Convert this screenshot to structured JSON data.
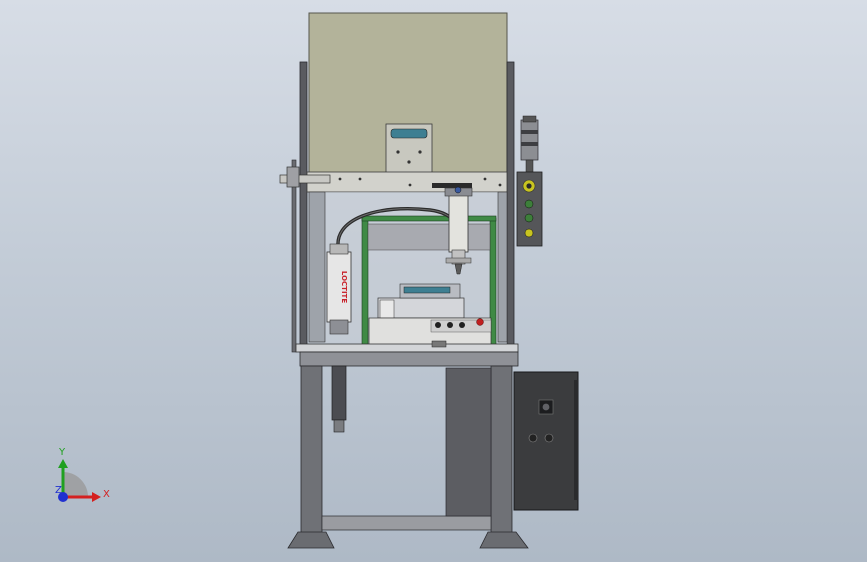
{
  "viewport": {
    "background_top": "#d7dde6",
    "background_bottom": "#aeb9c6"
  },
  "model": {
    "labels": {
      "dispenser_brand": "LOCTITE"
    },
    "colors": {
      "upper_panel": "#b3b39a",
      "frame_steel": "#4c4d52",
      "green_post": "#3f8a45",
      "control_cabinet": "#3b3c3e",
      "beacon_green": "#3d7f3a",
      "beacon_yellow": "#c8c420",
      "indicator_red": "#c02020"
    }
  },
  "triad": {
    "x_label": "X",
    "y_label": "Y",
    "z_label": "Z",
    "x_color": "#d42020",
    "y_color": "#20a020",
    "z_color": "#2030d0"
  }
}
